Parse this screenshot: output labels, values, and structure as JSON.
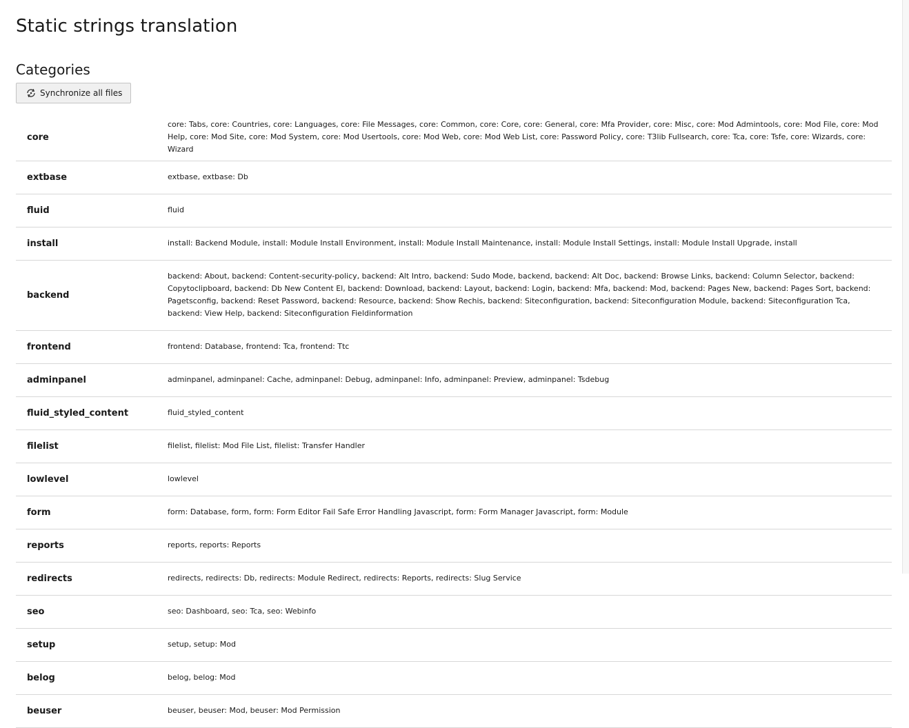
{
  "page": {
    "title": "Static strings translation",
    "section_title": "Categories",
    "sync_button_label": "Synchronize all files",
    "sync_icon": "sync-icon"
  },
  "categories": [
    {
      "name": "core",
      "items": "core: Tabs, core: Countries, core: Languages, core: File Messages, core: Common, core: Core, core: General, core: Mfa Provider, core: Misc, core: Mod Admintools, core: Mod File, core: Mod Help, core: Mod Site, core: Mod System, core: Mod Usertools, core: Mod Web, core: Mod Web List, core: Password Policy, core: T3lib Fullsearch, core: Tca, core: Tsfe, core: Wizards, core: Wizard"
    },
    {
      "name": "extbase",
      "items": "extbase, extbase: Db"
    },
    {
      "name": "fluid",
      "items": "fluid"
    },
    {
      "name": "install",
      "items": "install: Backend Module, install: Module Install Environment, install: Module Install Maintenance, install: Module Install Settings, install: Module Install Upgrade, install"
    },
    {
      "name": "backend",
      "items": "backend: About, backend: Content-security-policy, backend: Alt Intro, backend: Sudo Mode, backend, backend: Alt Doc, backend: Browse Links, backend: Column Selector, backend: Copytoclipboard, backend: Db New Content El, backend: Download, backend: Layout, backend: Login, backend: Mfa, backend: Mod, backend: Pages New, backend: Pages Sort, backend: Pagetsconfig, backend: Reset Password, backend: Resource, backend: Show Rechis, backend: Siteconfiguration, backend: Siteconfiguration Module, backend: Siteconfiguration Tca, backend: View Help, backend: Siteconfiguration Fieldinformation"
    },
    {
      "name": "frontend",
      "items": "frontend: Database, frontend: Tca, frontend: Ttc"
    },
    {
      "name": "adminpanel",
      "items": "adminpanel, adminpanel: Cache, adminpanel: Debug, adminpanel: Info, adminpanel: Preview, adminpanel: Tsdebug"
    },
    {
      "name": "fluid_styled_content",
      "items": "fluid_styled_content"
    },
    {
      "name": "filelist",
      "items": "filelist, filelist: Mod File List, filelist: Transfer Handler"
    },
    {
      "name": "lowlevel",
      "items": "lowlevel"
    },
    {
      "name": "form",
      "items": "form: Database, form, form: Form Editor Fail Safe Error Handling Javascript, form: Form Manager Javascript, form: Module"
    },
    {
      "name": "reports",
      "items": "reports, reports: Reports"
    },
    {
      "name": "redirects",
      "items": "redirects, redirects: Db, redirects: Module Redirect, redirects: Reports, redirects: Slug Service"
    },
    {
      "name": "seo",
      "items": "seo: Dashboard, seo: Tca, seo: Webinfo"
    },
    {
      "name": "setup",
      "items": "setup, setup: Mod"
    },
    {
      "name": "belog",
      "items": "belog, belog: Mod"
    },
    {
      "name": "beuser",
      "items": "beuser, beuser: Mod, beuser: Mod Permission"
    }
  ]
}
